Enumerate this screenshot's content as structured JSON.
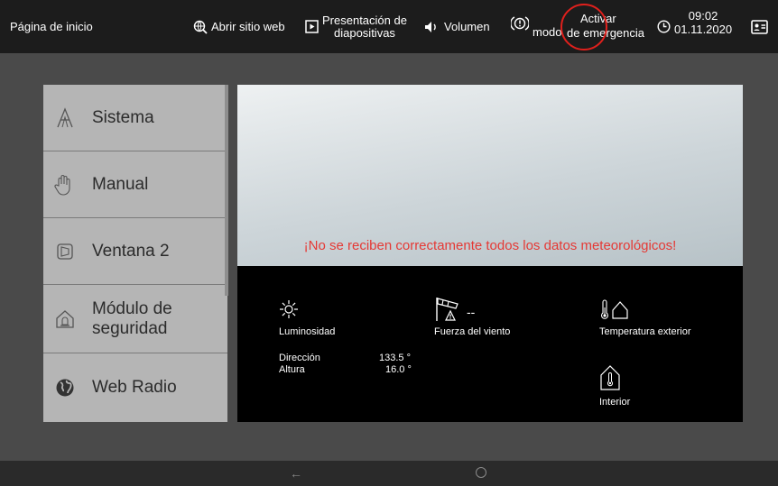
{
  "header": {
    "title": "Página de inicio",
    "open_website": "Abrir sitio web",
    "slideshow_line1": "Presentación de",
    "slideshow_line2": "diapositivas",
    "volume": "Volumen",
    "emergency_line1": "Activar",
    "emergency_line2a": "modo",
    "emergency_line2b": "de emergencia",
    "time": "09:02",
    "date": "01.11.2020"
  },
  "sidebar": {
    "items": [
      {
        "label": "Sistema",
        "icon": "system-a-icon"
      },
      {
        "label": "Manual",
        "icon": "hand-icon"
      },
      {
        "label": "Ventana 2",
        "icon": "window-icon"
      },
      {
        "label_line1": "Módulo de",
        "label_line2": "seguridad",
        "icon": "security-house-icon"
      },
      {
        "label": "Web Radio",
        "icon": "globe-icon"
      }
    ]
  },
  "weather": {
    "warning": "¡No se reciben correctamente todos los datos meteorológicos!",
    "brightness_label": "Luminosidad",
    "wind_value": "--",
    "wind_label": "Fuerza del viento",
    "outdoor_temp_label": "Temperatura exterior",
    "direction_label": "Dirección",
    "direction_value": "133.5 °",
    "height_label": "Altura",
    "height_value": "16.0 °",
    "indoor_label": "Interior"
  },
  "colors": {
    "topbar": "#1c1c1c",
    "accent_red": "#e53935",
    "sidebar": "#b5b5b5",
    "panel": "#000000"
  }
}
